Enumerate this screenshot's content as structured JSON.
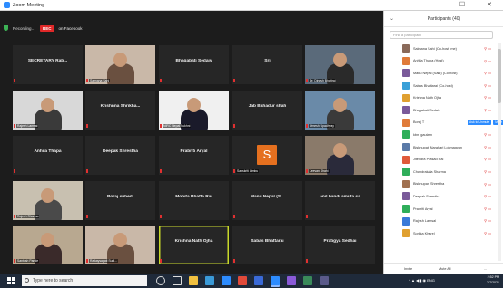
{
  "window": {
    "title": "Zoom Meeting",
    "controls": [
      "—",
      "☐",
      "✕"
    ]
  },
  "meeting_bar": {
    "view_label": "Recording…",
    "rec_badge": "REC",
    "rec_status": "on Facebook"
  },
  "tiles": [
    {
      "name": "SECRETARY Rab...",
      "tag": "",
      "kind": "name"
    },
    {
      "name": "",
      "tag": "Salmana Sahi",
      "kind": "video"
    },
    {
      "name": "Bhagabati Sedaiv",
      "tag": "",
      "kind": "name"
    },
    {
      "name": "Sri",
      "tag": "",
      "kind": "name"
    },
    {
      "name": "",
      "tag": "Dr. Dinesh Bhattrai",
      "kind": "video"
    },
    {
      "name": "",
      "tag": "Rajesh Lamsal",
      "kind": "video"
    },
    {
      "name": "Krishnna Shrikha...",
      "tag": "",
      "kind": "name"
    },
    {
      "name": "",
      "tag": "NIRC Nepal Sukhni",
      "kind": "video"
    },
    {
      "name": "Jab Bahadur shah",
      "tag": "",
      "kind": "name"
    },
    {
      "name": "",
      "tag": "Umesh Upadhyay",
      "kind": "video"
    },
    {
      "name": "Anhila Thapa",
      "tag": "",
      "kind": "name"
    },
    {
      "name": "Deepak Shrestha",
      "tag": "",
      "kind": "name"
    },
    {
      "name": "Prabriti Aryal",
      "tag": "",
      "kind": "name"
    },
    {
      "name": "",
      "tag": "Sanskriti Limbu",
      "kind": "letter",
      "letter": "S"
    },
    {
      "name": "",
      "tag": "Jeevan Shahi",
      "kind": "video"
    },
    {
      "name": "",
      "tag": "Rajesh Sharma",
      "kind": "video"
    },
    {
      "name": "Boraj subedi",
      "tag": "",
      "kind": "name"
    },
    {
      "name": "Mohita Bhatta Rai",
      "tag": "",
      "kind": "name"
    },
    {
      "name": "Manu Nepal (S...",
      "tag": "",
      "kind": "name"
    },
    {
      "name": "anil bandi amuta sa",
      "tag": "",
      "kind": "name"
    },
    {
      "name": "",
      "tag": "Santosh Pande",
      "kind": "video"
    },
    {
      "name": "",
      "tag": "Raikaysapati Sudi...",
      "kind": "video"
    },
    {
      "name": "Krishna Nath Ojha",
      "tag": "",
      "kind": "name",
      "active": true
    },
    {
      "name": "Sabas Bhattarai",
      "tag": "",
      "kind": "name"
    },
    {
      "name": "Pratigya Sedhai",
      "tag": "",
      "kind": "name"
    }
  ],
  "panel": {
    "title": "Participants (40)",
    "search_placeholder": "Find a participant",
    "participants": [
      {
        "name": "Salmana Sahi (Co-host, me)",
        "color": "#8a6a5a",
        "extra": "",
        "btn1": "",
        "btn2": ""
      },
      {
        "name": "Anhila Thapa (Host)",
        "color": "#e07b39",
        "extra": "",
        "btn1": "",
        "btn2": ""
      },
      {
        "name": "Manu Nepal (Sahi) (Co-host)",
        "color": "#7a5a9a",
        "extra": "",
        "btn1": "",
        "btn2": ""
      },
      {
        "name": "Sabas Bhattarai (Co-host)",
        "color": "#3aa0d8",
        "extra": "",
        "btn1": "",
        "btn2": ""
      },
      {
        "name": "Krishna Nath Ojha",
        "color": "#e0a030",
        "extra": "",
        "btn1": "",
        "btn2": ""
      },
      {
        "name": "Bhagabati Sedaiv",
        "color": "#7a5a9a",
        "extra": "",
        "btn1": "",
        "btn2": ""
      },
      {
        "name": "Boraj T",
        "color": "#e07b39",
        "extra": "",
        "btn1": "Ask to Unmute",
        "btn2": "More"
      },
      {
        "name": "kbm gautam",
        "color": "#2fae5a",
        "extra": "",
        "btn1": "",
        "btn2": ""
      },
      {
        "name": "Bishnupati Narahari Lokmagyan",
        "color": "#5a7aa8",
        "extra": "",
        "btn1": "",
        "btn2": ""
      },
      {
        "name": "Jitendra Prasad Rai",
        "color": "#e05a3a",
        "extra": "",
        "btn1": "",
        "btn2": ""
      },
      {
        "name": "Chandrakala Sharma",
        "color": "#2fae5a",
        "extra": "",
        "btn1": "",
        "btn2": ""
      },
      {
        "name": "Bishnupan Shrestha",
        "color": "#a07050",
        "extra": "",
        "btn1": "",
        "btn2": ""
      },
      {
        "name": "Deepak Shrestha",
        "color": "#7a5a9a",
        "extra": "",
        "btn1": "",
        "btn2": ""
      },
      {
        "name": "Prabriti Aryal",
        "color": "#2fae5a",
        "extra": "",
        "btn1": "",
        "btn2": ""
      },
      {
        "name": "Rajesh Lamsal",
        "color": "#3a7ad8",
        "extra": "",
        "btn1": "",
        "btn2": ""
      },
      {
        "name": "Sonika Kharel",
        "color": "#e0a030",
        "extra": "",
        "btn1": "",
        "btn2": ""
      }
    ],
    "footer_left": "Invite",
    "footer_mid": "Mute All",
    "footer_right": "..."
  },
  "taskbar": {
    "search_placeholder": "Type here to search",
    "time": "2:52 PM",
    "date": "2/7/2021",
    "tray": "ENG"
  },
  "colors": {
    "accent": "#2d8cff",
    "rec": "#e02828",
    "active_border": "#c8d82a"
  }
}
